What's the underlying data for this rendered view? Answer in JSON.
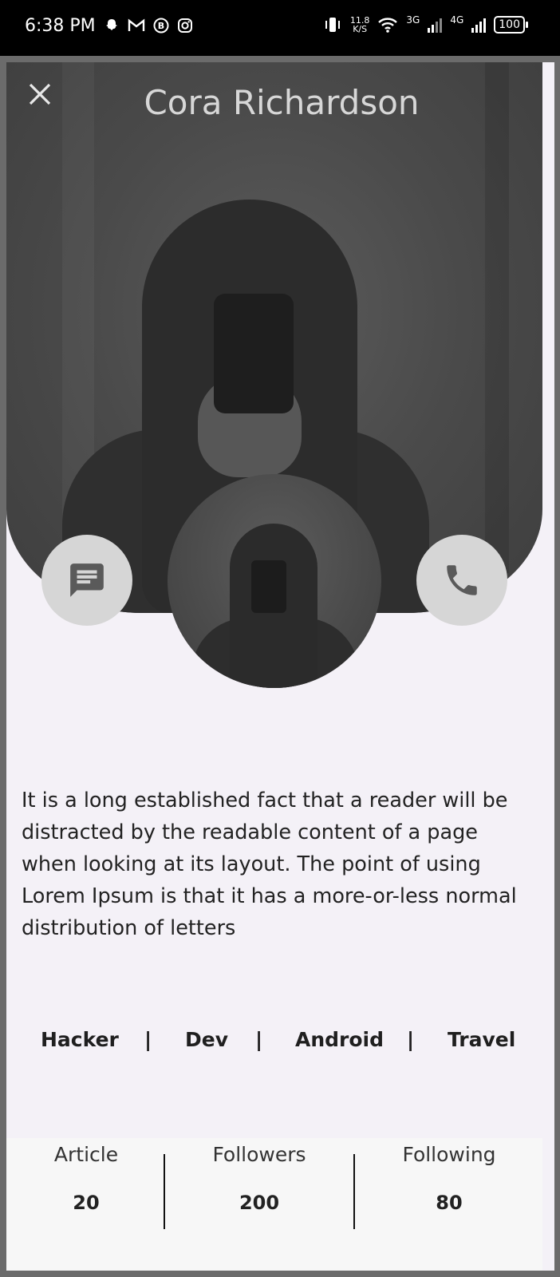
{
  "status_bar": {
    "time": "6:38 PM",
    "net_speed_top": "11.8",
    "net_speed_bottom": "K/S",
    "net_3g": "3G",
    "net_4g": "4G",
    "battery": "100"
  },
  "header": {
    "title": "Cora Richardson",
    "close_icon": "close-icon"
  },
  "actions": {
    "message_icon": "message-icon",
    "call_icon": "phone-icon"
  },
  "description": "It is a long established fact that a reader will be distracted by the readable content of a page when looking at its layout. The point of using Lorem Ipsum is that it has a more-or-less normal distribution of letters",
  "tags": [
    "Hacker",
    "Dev",
    "Android",
    "Travel"
  ],
  "tag_separator": "|",
  "stats": [
    {
      "label": "Article",
      "value": "20"
    },
    {
      "label": "Followers",
      "value": "200"
    },
    {
      "label": "Following",
      "value": "80"
    }
  ],
  "colors": {
    "background": "#f4f1f7",
    "button_bg": "#d6d6d6",
    "icon": "#5a5a5a",
    "status_bar": "#000000"
  }
}
